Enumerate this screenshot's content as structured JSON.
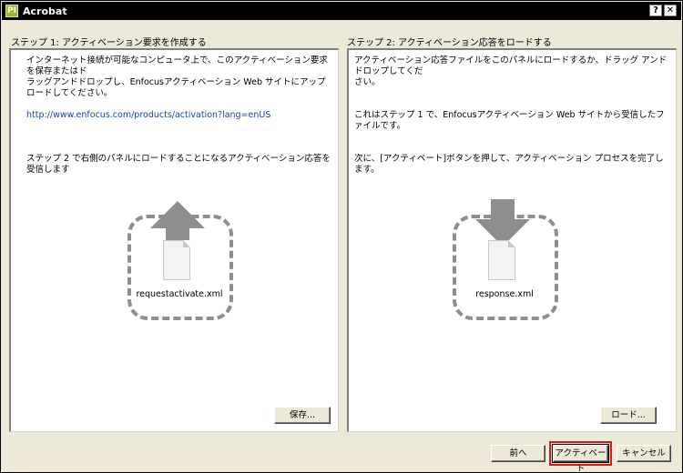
{
  "window": {
    "title": "Acrobat",
    "app_icon_text": "PI",
    "help_label": "?",
    "close_label": "✕"
  },
  "step1": {
    "title": "ステップ 1: アクティベーション要求を作成する",
    "instructions": "インターネット接続が可能なコンピュータ上で、このアクティベーション要求を保存またはド\nラッグアンドドロップし、Enfocusアクティベーション Web サイトにアップロードしてください。",
    "link": "http://www.enfocus.com/products/activation?lang=enUS",
    "note": "ステップ 2 で右側のパネルにロードすることになるアクティベーション応答を受信します",
    "file_name": "requestactivate.xml",
    "save_button": "保存..."
  },
  "step2": {
    "title": "ステップ 2: アクティベーション応答をロードする",
    "instructions": "アクティベーション応答ファイルをこのパネルにロードするか、ドラッグ アンド ドロップしてくだ\nさい。",
    "note1": "これはステップ 1 で、Enfocusアクティベーション Web サイトから受信したファイルです。",
    "note2": "次に、[アクティベート]ボタンを押して、アクティベーション プロセスを完了します。",
    "file_name": "response.xml",
    "load_button": "ロード..."
  },
  "footer": {
    "back_button": "前へ",
    "activate_button": "アクティベート",
    "cancel_button": "キャンセル"
  },
  "icons": {
    "upload": "upload-arrow-icon",
    "download": "download-arrow-icon",
    "file": "file-icon"
  },
  "colors": {
    "title_bar": "#000000",
    "link": "#1f3fa8",
    "arrow": "#8e8e8e",
    "highlight": "#e01414"
  }
}
